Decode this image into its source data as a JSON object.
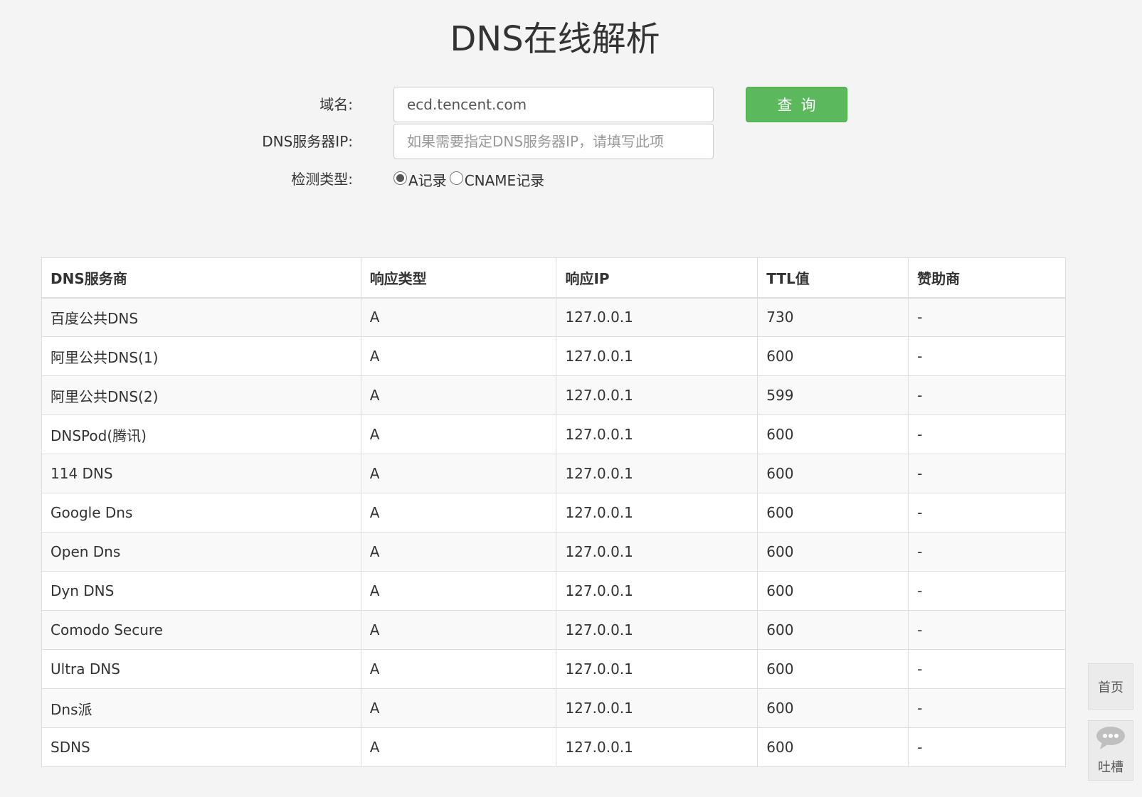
{
  "title": "DNS在线解析",
  "form": {
    "domain_label": "域名:",
    "domain_value": "ecd.tencent.com",
    "dns_server_label": "DNS服务器IP:",
    "dns_server_value": "",
    "dns_server_placeholder": "如果需要指定DNS服务器IP，请填写此项",
    "type_label": "检测类型:",
    "type_options": [
      {
        "label": "A记录",
        "checked": true
      },
      {
        "label": "CNAME记录",
        "checked": false
      }
    ],
    "query_button": "查询"
  },
  "table": {
    "headers": [
      "DNS服务商",
      "响应类型",
      "响应IP",
      "TTL值",
      "赞助商"
    ],
    "rows": [
      [
        "百度公共DNS",
        "A",
        "127.0.0.1",
        "730",
        "-"
      ],
      [
        "阿里公共DNS(1)",
        "A",
        "127.0.0.1",
        "600",
        "-"
      ],
      [
        "阿里公共DNS(2)",
        "A",
        "127.0.0.1",
        "599",
        "-"
      ],
      [
        "DNSPod(腾讯)",
        "A",
        "127.0.0.1",
        "600",
        "-"
      ],
      [
        "114 DNS",
        "A",
        "127.0.0.1",
        "600",
        "-"
      ],
      [
        "Google Dns",
        "A",
        "127.0.0.1",
        "600",
        "-"
      ],
      [
        "Open Dns",
        "A",
        "127.0.0.1",
        "600",
        "-"
      ],
      [
        "Dyn DNS",
        "A",
        "127.0.0.1",
        "600",
        "-"
      ],
      [
        "Comodo Secure",
        "A",
        "127.0.0.1",
        "600",
        "-"
      ],
      [
        "Ultra DNS",
        "A",
        "127.0.0.1",
        "600",
        "-"
      ],
      [
        "Dns派",
        "A",
        "127.0.0.1",
        "600",
        "-"
      ],
      [
        "SDNS",
        "A",
        "127.0.0.1",
        "600",
        "-"
      ]
    ]
  },
  "side": {
    "home_label": "首页",
    "feedback_label": "吐槽",
    "feedback_icon": "chat-bubble-icon"
  },
  "colors": {
    "background": "#f4f4f4",
    "button": "#5cb85c",
    "border": "#dddddd"
  }
}
